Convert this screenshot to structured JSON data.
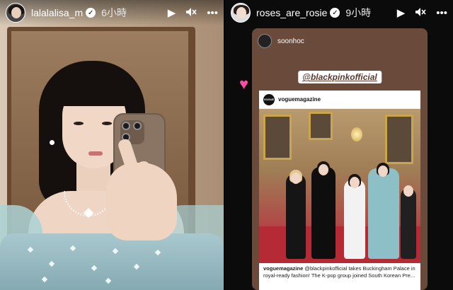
{
  "left_story": {
    "username": "lalalalisa_m",
    "time": "6小時",
    "verified": true
  },
  "right_story": {
    "username": "roses_are_rosie",
    "time": "9小時",
    "verified": true,
    "repost_user": "soonhoc",
    "mention": "@blackpinkofficial",
    "sticker": "heart",
    "post": {
      "username": "voguemagazine",
      "logo_text": "VOGUE",
      "caption_user": "voguemagazine",
      "caption_text": "@blackpinkofficial takes Buckingham Palace in royal-ready fashion! The K-pop group joined South Korean Pre..."
    }
  },
  "icons": {
    "play": "▶",
    "mute": "🔇",
    "more": "•••",
    "verified": "✓",
    "heart": "♥"
  },
  "colors": {
    "verified_badge": "#ffffff",
    "heart_sticker": "#ff4fa3",
    "story_card_bg": "#6a4a3a"
  }
}
